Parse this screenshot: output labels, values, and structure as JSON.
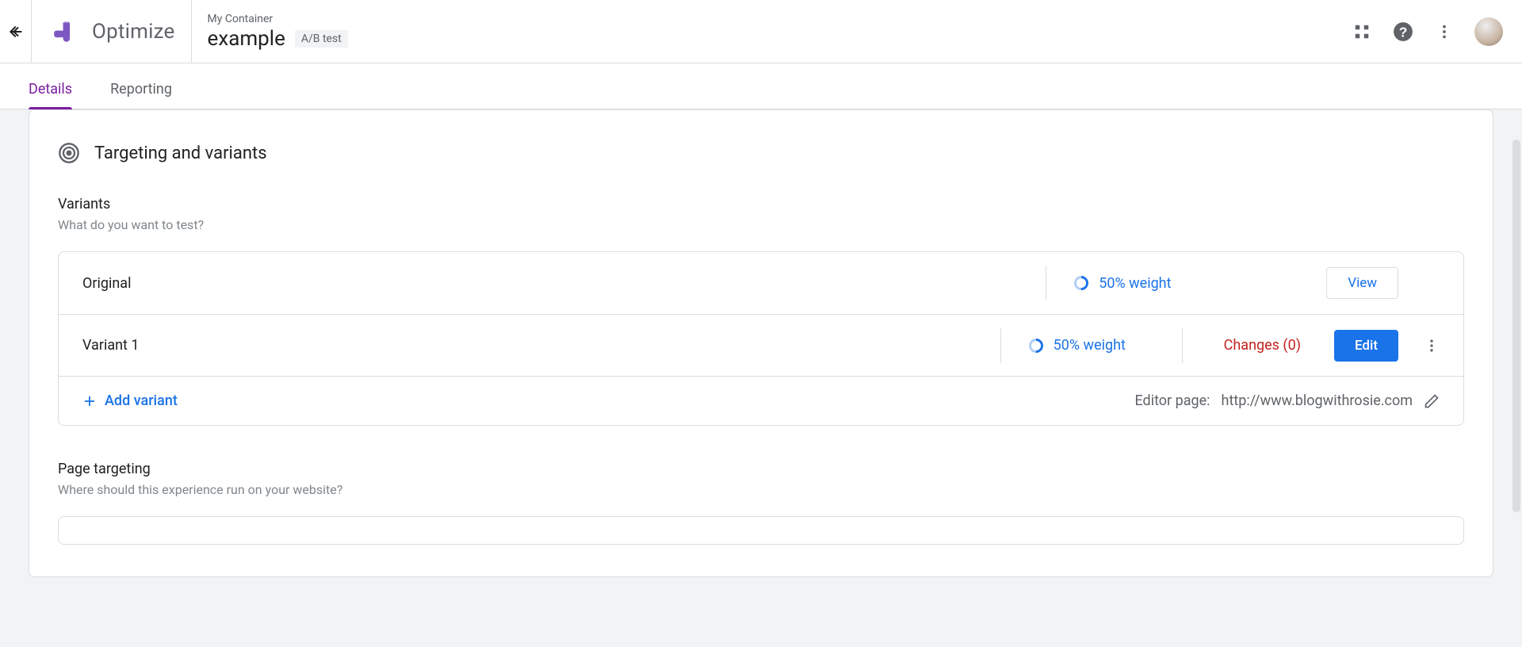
{
  "header": {
    "brand": "Optimize",
    "container_label": "My Container",
    "experiment_name": "example",
    "experiment_type": "A/B test"
  },
  "tabs": {
    "details": "Details",
    "reporting": "Reporting"
  },
  "section": {
    "title": "Targeting and variants",
    "variants_heading": "Variants",
    "variants_desc": "What do you want to test?",
    "page_targeting_heading": "Page targeting",
    "page_targeting_desc": "Where should this experience run on your website?"
  },
  "variants": [
    {
      "name": "Original",
      "weight": "50% weight",
      "view_label": "View"
    },
    {
      "name": "Variant 1",
      "weight": "50% weight",
      "changes": "Changes (0)",
      "edit_label": "Edit"
    }
  ],
  "add_variant_label": "Add variant",
  "editor_page": {
    "label": "Editor page:",
    "url": "http://www.blogwithrosie.com"
  }
}
